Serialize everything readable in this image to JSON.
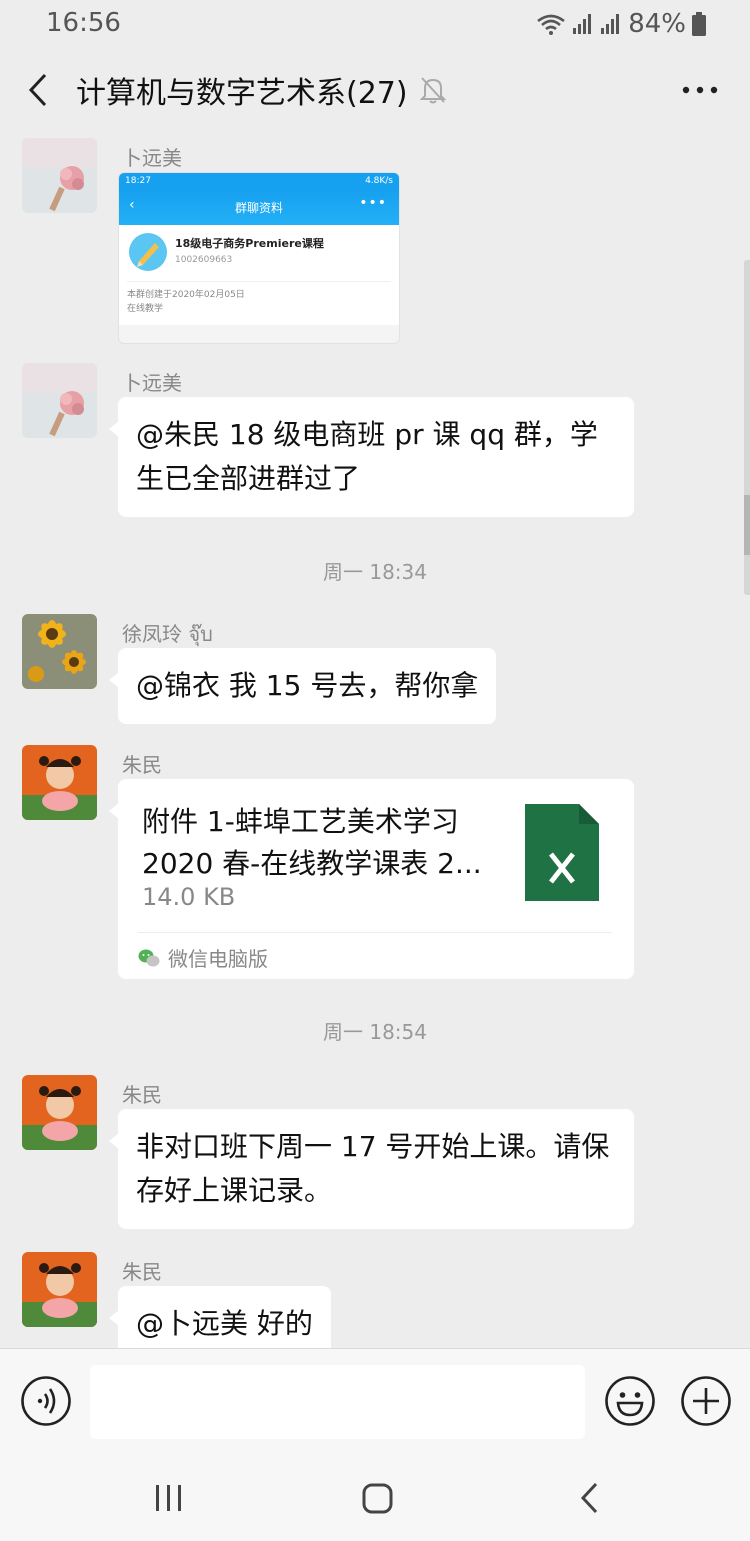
{
  "status_bar": {
    "time": "16:56",
    "battery": "84%",
    "icons": [
      "wifi-icon",
      "signal-icon",
      "signal-icon",
      "battery-icon"
    ]
  },
  "nav": {
    "title": "计算机与数字艺术系(27)",
    "icons": [
      "back-icon",
      "mute-bell-icon",
      "more-icon"
    ]
  },
  "messages": [
    {
      "type": "image",
      "sender": "卜远美",
      "screenshot": {
        "status_time": "18:27",
        "status_info": "4.8K/s",
        "header_title": "群聊资料",
        "group_name": "18级电子商务Premiere课程",
        "group_id": "1002609663",
        "created": "本群创建于2020年02月05日",
        "mode": "在线教学"
      }
    },
    {
      "type": "text",
      "sender": "卜远美",
      "text": "@朱民  18 级电商班 pr 课 qq 群，学生已全部进群过了"
    },
    {
      "type": "time",
      "text": "周一 18:34"
    },
    {
      "type": "text",
      "sender": "徐凤玲 จุ๊บ",
      "text": "@锦衣  我 15 号去，帮你拿"
    },
    {
      "type": "file",
      "sender": "朱民",
      "file_name": "附件 1-蚌埠工艺美术学习2020 春-在线教学课表 2...",
      "file_size": "14.0 KB",
      "source": "微信电脑版",
      "file_icon": "excel-file-icon"
    },
    {
      "type": "time",
      "text": "周一 18:54"
    },
    {
      "type": "text",
      "sender": "朱民",
      "text": "非对口班下周一 17 号开始上课。请保存好上课记录。"
    },
    {
      "type": "text",
      "sender": "朱民",
      "text": "@卜远美  好的"
    }
  ],
  "input_bar": {
    "value": "",
    "icons": [
      "voice-icon",
      "emoji-icon",
      "plus-icon"
    ]
  },
  "system_nav": {
    "icons": [
      "recents-icon",
      "home-icon",
      "back-icon"
    ]
  },
  "colors": {
    "background": "#ededed",
    "bubble": "#ffffff",
    "excel_green": "#1f7244",
    "qq_blue": "#16a0f0"
  }
}
